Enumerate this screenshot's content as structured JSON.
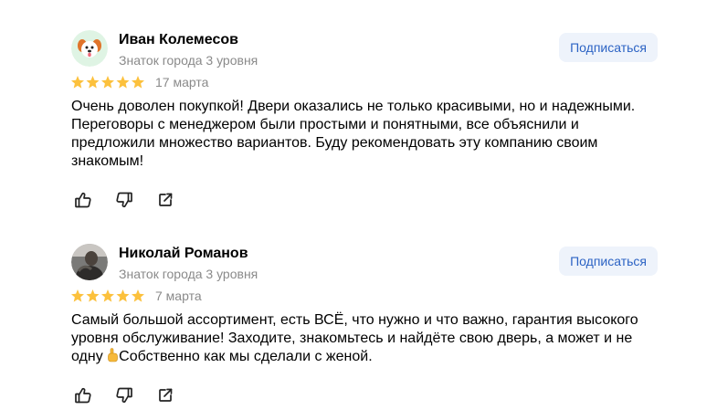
{
  "reviews": [
    {
      "author": "Иван Колемесов",
      "level": "Знаток города 3 уровня",
      "subscribe_label": "Подписаться",
      "rating": 5,
      "date": "17 марта",
      "text": "Очень доволен покупкой! Двери оказались не только красивыми, но и надежными.\nПереговоры с менеджером были простыми и понятными, все объяснили и\nпредложили множество вариантов. Буду рекомендовать эту компанию своим\nзнакомым!",
      "avatar_icon": "dog-avatar-icon"
    },
    {
      "author": "Николай Романов",
      "level": "Знаток города 3 уровня",
      "subscribe_label": "Подписаться",
      "rating": 5,
      "date": "7 марта",
      "text_part1": "Самый большой ассортимент, есть ВСЁ, что нужно и что важно, гарантия высокого\nуровня обслуживание! Заходите, знакомьтесь и найдёте свою дверь, а может и не\nодну ",
      "text_part2": "Собственно как мы сделали с женой.",
      "avatar_icon": "person-photo-avatar"
    }
  ],
  "colors": {
    "star": "#fcc13d",
    "subscribe_bg": "#eef3fb",
    "subscribe_text": "#2c63c4",
    "muted_text": "#8a8a8a"
  }
}
